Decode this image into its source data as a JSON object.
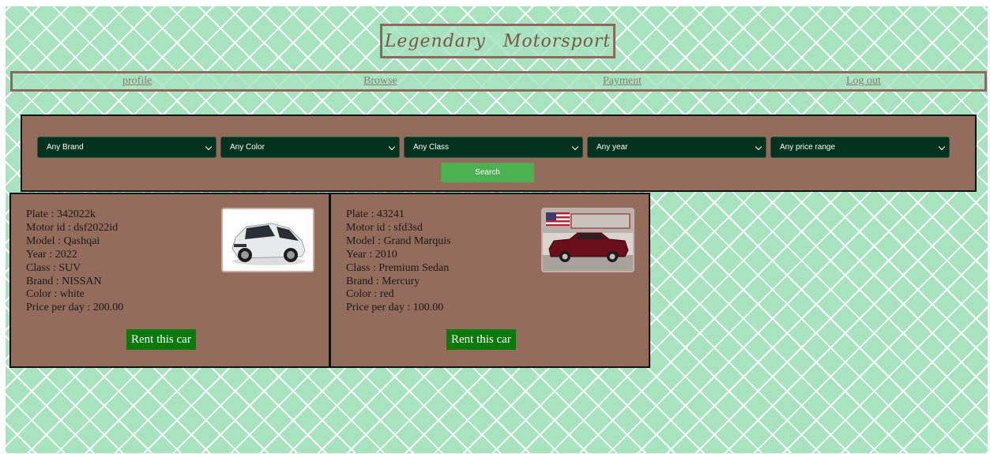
{
  "header": {
    "logo_text": "Legendary Motorsport"
  },
  "nav": {
    "profile": "profile",
    "browse": "Browse",
    "payment": "Payment",
    "logout": "Log out"
  },
  "filters": {
    "brand": "Any Brand",
    "color": "Any Color",
    "class": "Any Class",
    "year": "Any year",
    "price": "Any price range",
    "search_label": "Search"
  },
  "cars": [
    {
      "plate": "Plate : 342022k",
      "motor_id": "Motor id : dsf2022id",
      "model": "Model : Qashqai",
      "year": "Year : 2022",
      "class": "Class : SUV",
      "brand": "Brand : NISSAN",
      "color": "Color : white",
      "price": "Price per day : 200.00",
      "rent_label": "Rent this car"
    },
    {
      "plate": "Plate : 43241",
      "motor_id": "Motor id : sfd3sd",
      "model": "Model : Grand Marquis",
      "year": "Year : 2010",
      "class": "Class : Premium Sedan",
      "brand": "Brand : Mercury",
      "color": "Color : red",
      "price": "Price per day : 100.00",
      "rent_label": "Rent this car"
    }
  ],
  "colors": {
    "background": "#a8e3bf",
    "panel": "#936c5b",
    "select": "#003320",
    "search_button": "#4caf50",
    "rent_button": "#0a7a0a",
    "border_brown": "#8b6a5b"
  }
}
